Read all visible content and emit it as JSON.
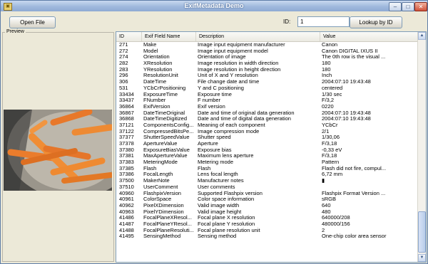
{
  "window": {
    "title": "ExifMetadata Demo",
    "minimize": "–",
    "maximize": "□",
    "close": "✕"
  },
  "toolbar": {
    "open_label": "Open File",
    "id_label": "ID:",
    "id_value": "1",
    "lookup_label": "Lookup by ID"
  },
  "preview": {
    "label": "Preview"
  },
  "grid": {
    "headers": [
      "ID",
      "Exif Field Name",
      "Description",
      "Value"
    ],
    "rows": [
      [
        "271",
        "Make",
        "Image input equipment manufacturer",
        "Canon"
      ],
      [
        "272",
        "Model",
        "Image input equipment model",
        "Canon DIGITAL IXUS II"
      ],
      [
        "274",
        "Orientation",
        "Orientation of image",
        "The 0th row is the visual ..."
      ],
      [
        "282",
        "XResolution",
        "Image resolution in width direction",
        "180"
      ],
      [
        "283",
        "YResolution",
        "Image resolution in height direction",
        "180"
      ],
      [
        "296",
        "ResolutionUnit",
        "Unit of X and Y resolution",
        "Inch"
      ],
      [
        "306",
        "DateTime",
        "File change date and time",
        "2004:07:10 19:43:48"
      ],
      [
        "531",
        "YCbCrPositioning",
        "Y and C positioning",
        "centered"
      ],
      [
        "33434",
        "ExposureTime",
        "Exposure time",
        "1/30 sec"
      ],
      [
        "33437",
        "FNumber",
        "F number",
        "F/3,2"
      ],
      [
        "36864",
        "ExifVersion",
        "Exif version",
        "0220"
      ],
      [
        "36867",
        "DateTimeOriginal",
        "Date and time of original data generation",
        "2004:07:10 19:43:48"
      ],
      [
        "36868",
        "DateTimeDigitized",
        "Date and time of digital data generation",
        "2004:07:10 19:43:48"
      ],
      [
        "37121",
        "ComponentsConfig...",
        "Meaning of each component",
        "YCbCr"
      ],
      [
        "37122",
        "CompressedBitsPe...",
        "Image compression mode",
        "2/1"
      ],
      [
        "37377",
        "ShutterSpeedValue",
        "Shutter speed",
        "1/30,06"
      ],
      [
        "37378",
        "ApertureValue",
        "Aperture",
        "F/3,18"
      ],
      [
        "37380",
        "ExposureBiasValue",
        "Exposure bias",
        "-0,33 eV"
      ],
      [
        "37381",
        "MaxApertureValue",
        "Maximum lens aperture",
        "F/3,18"
      ],
      [
        "37383",
        "MeteringMode",
        "Metering mode",
        "Pattern"
      ],
      [
        "37385",
        "Flash",
        "Flash",
        "Flash did not fire, compul..."
      ],
      [
        "37386",
        "FocalLength",
        "Lens focal length",
        "6,72 mm"
      ],
      [
        "37500",
        "MakerNote",
        "Manufacturer notes",
        "▮"
      ],
      [
        "37510",
        "UserComment",
        "User comments",
        ""
      ],
      [
        "40960",
        "FlashpixVersion",
        "Supported Flashpix version",
        "Flashpix Format Version ..."
      ],
      [
        "40961",
        "ColorSpace",
        "Color space information",
        "sRGB"
      ],
      [
        "40962",
        "PixelXDimension",
        "Valid image width",
        "640"
      ],
      [
        "40963",
        "PixelYDimension",
        "Valid image height",
        "480"
      ],
      [
        "41486",
        "FocalPlaneXResol...",
        "Focal plane X resolution",
        "640000/208"
      ],
      [
        "41487",
        "FocalPlaneYResol...",
        "Focal plane Y resolution",
        "480000/156"
      ],
      [
        "41488",
        "FocalPlaneResoluti...",
        "Focal plane resolution unit",
        "2"
      ],
      [
        "41495",
        "SensingMethod",
        "Sensing method",
        "One-chip color area sensor"
      ]
    ]
  }
}
